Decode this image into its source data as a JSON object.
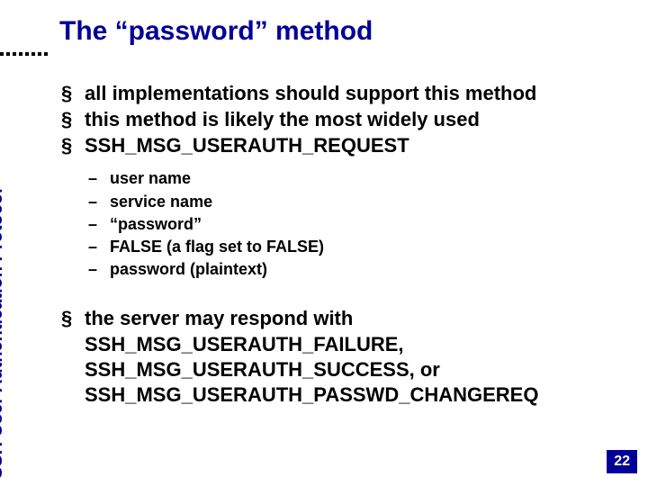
{
  "title": "The “password” method",
  "sidebar_label": "SSH User Authentication Protocol",
  "bullets_top": [
    "all implementations should support this method",
    "this method is likely the most widely used",
    "SSH_MSG_USERAUTH_REQUEST"
  ],
  "sub_items": [
    "user name",
    "service name",
    "“password”",
    "FALSE (a flag set to FALSE)",
    "password (plaintext)"
  ],
  "bullets_bottom": [
    "the server may respond with SSH_MSG_USERAUTH_FAILURE, SSH_MSG_USERAUTH_SUCCESS, or SSH_MSG_USERAUTH_PASSWD_CHANGEREQ"
  ],
  "page_number": "22"
}
